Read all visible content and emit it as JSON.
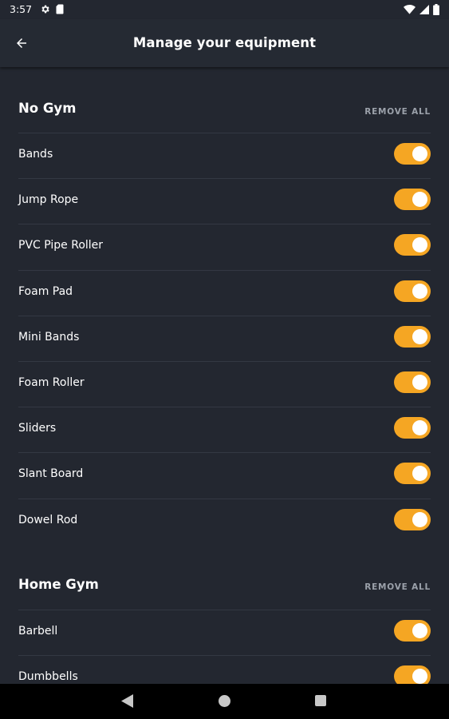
{
  "status_bar": {
    "time": "3:57",
    "icons": [
      "gear-icon",
      "sd-card-icon",
      "wifi-icon",
      "signal-icon",
      "battery-icon"
    ]
  },
  "app_bar": {
    "title": "Manage your equipment",
    "back_icon": "arrow-left-icon"
  },
  "colors": {
    "background": "#232730",
    "toggle_on": "#f5a623",
    "remove_all": "#9ba1aa"
  },
  "sections": [
    {
      "title": "No Gym",
      "action": "REMOVE ALL",
      "items": [
        {
          "label": "Bands",
          "enabled": true
        },
        {
          "label": "Jump Rope",
          "enabled": true
        },
        {
          "label": "PVC Pipe Roller",
          "enabled": true
        },
        {
          "label": "Foam Pad",
          "enabled": true
        },
        {
          "label": "Mini Bands",
          "enabled": true
        },
        {
          "label": "Foam Roller",
          "enabled": true
        },
        {
          "label": "Sliders",
          "enabled": true
        },
        {
          "label": "Slant Board",
          "enabled": true
        },
        {
          "label": "Dowel Rod",
          "enabled": true
        }
      ]
    },
    {
      "title": "Home Gym",
      "action": "REMOVE ALL",
      "items": [
        {
          "label": "Barbell",
          "enabled": true
        },
        {
          "label": "Dumbbells",
          "enabled": true
        }
      ]
    }
  ],
  "nav_bar": {
    "icons": [
      "back-triangle-icon",
      "home-circle-icon",
      "recents-square-icon"
    ]
  }
}
